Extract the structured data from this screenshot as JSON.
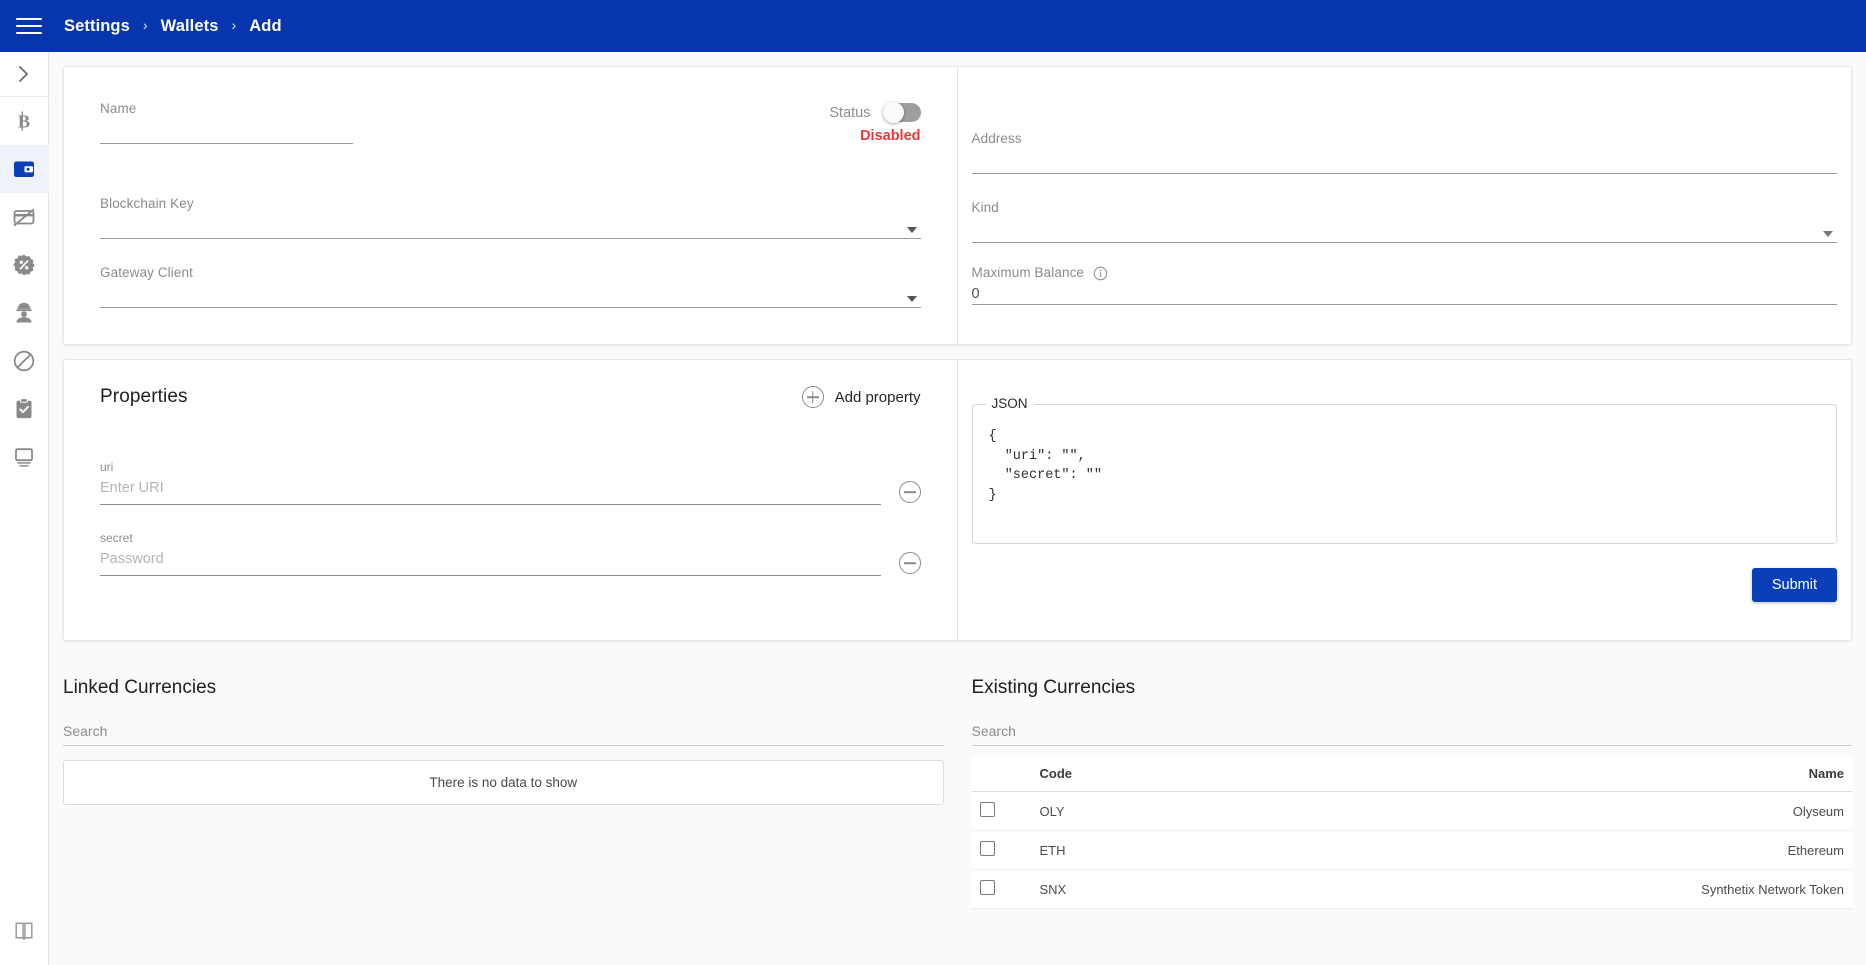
{
  "header": {
    "menu_icon": "hamburger-icon",
    "breadcrumbs": [
      "Settings",
      "Wallets",
      "Add"
    ],
    "separator": "›",
    "background": "#0635ad"
  },
  "sidebar": {
    "expand_icon": "chevron-right-icon",
    "items": [
      {
        "icon": "bitcoin-icon",
        "active": false
      },
      {
        "icon": "wallet-icon",
        "active": true
      },
      {
        "icon": "card-off-icon",
        "active": false
      },
      {
        "icon": "discount-badge-icon",
        "active": false
      },
      {
        "icon": "engineer-icon",
        "active": false
      },
      {
        "icon": "block-icon",
        "active": false
      },
      {
        "icon": "clipboard-check-icon",
        "active": false
      },
      {
        "icon": "monitor-icon",
        "active": false
      }
    ],
    "bottom_icon": "book-icon",
    "active_color": "#0b3fb8"
  },
  "form": {
    "name": {
      "label": "Name",
      "value": ""
    },
    "status": {
      "label": "Status",
      "value": "Disabled",
      "enabled": false,
      "value_color": "#e53935"
    },
    "blockchain_key": {
      "label": "Blockchain Key",
      "value": ""
    },
    "gateway_client": {
      "label": "Gateway Client",
      "value": ""
    },
    "address": {
      "label": "Address",
      "value": ""
    },
    "kind": {
      "label": "Kind",
      "value": ""
    },
    "maximum_balance": {
      "label": "Maximum Balance",
      "info_icon": "info-icon",
      "value": "0"
    }
  },
  "properties": {
    "title": "Properties",
    "add_label": "Add property",
    "add_icon": "plus-circle-icon",
    "remove_icon": "minus-circle-icon",
    "rows": [
      {
        "key": "uri",
        "placeholder": "Enter URI",
        "value": ""
      },
      {
        "key": "secret",
        "placeholder": "Password",
        "value": ""
      }
    ]
  },
  "json_preview": {
    "legend": "JSON",
    "code": "{\n  \"uri\": \"\",\n  \"secret\": \"\"\n}"
  },
  "submit": {
    "label": "Submit",
    "color": "#0b3fb8"
  },
  "linked_currencies": {
    "title": "Linked Currencies",
    "search_placeholder": "Search",
    "search_value": "",
    "empty_message": "There is no data to show"
  },
  "existing_currencies": {
    "title": "Existing Currencies",
    "search_placeholder": "Search",
    "search_value": "",
    "columns": [
      "",
      "Code",
      "Name"
    ],
    "rows": [
      {
        "checked": false,
        "code": "OLY",
        "name": "Olyseum"
      },
      {
        "checked": false,
        "code": "ETH",
        "name": "Ethereum"
      },
      {
        "checked": false,
        "code": "SNX",
        "name": "Synthetix Network Token"
      }
    ]
  }
}
